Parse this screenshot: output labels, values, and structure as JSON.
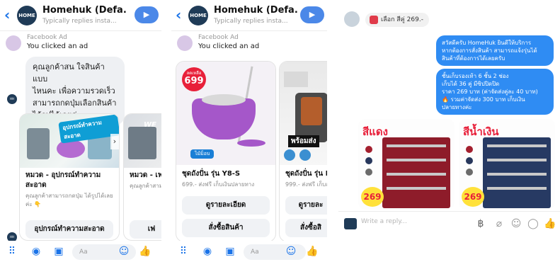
{
  "colors": {
    "accent": "#1a73e8",
    "bubble_blue": "#2f8cf3",
    "brand_dark": "#1f3b57",
    "promo_red": "#e8203a"
  },
  "header": {
    "name": "Homehuk (Defa...",
    "subtitle": "Typically replies insta...",
    "logo_text": "HOME"
  },
  "ad": {
    "label": "Facebook Ad",
    "text": "You clicked an ad"
  },
  "panel1": {
    "bot_message": [
      "คุณลูกค้าสน ใจสินค้าแบบ",
      "ไหนคะ เพื่อความรวดเร็ว",
      "สามารถกดปุ่มเลือกสินค้า",
      "ได้รูปได้เลยค่ะ"
    ],
    "card1": {
      "image_badge": "อุปกรณ์ทำความสะอาด",
      "title": "หมวด - อุปกรณ์ทำความสะอาด",
      "subtitle": "คุณลูกค้าสามารถกดปุ่ม ได้รูปได้เลยค่ะ 👇",
      "button": "อุปกรณ์ทำความสะอาด"
    },
    "card2": {
      "title": "หมวด - เฟ",
      "subtitle": "คุณลูกค้าสามารถ",
      "button": "เฟ"
    }
  },
  "panel2": {
    "card1": {
      "price_label": "ลดเหลือ",
      "price": "699",
      "image_badge": "ไม้ม็อบ",
      "title": "ชุดถังปั่น รุ่น Y8-S",
      "subtitle": "699.- ส่งฟรี เก็บเงินปลายทาง",
      "button1": "ดูรายละเอียด",
      "button2": "สั่งซื้อสินค้า"
    },
    "card2": {
      "image_badge": "พร้อมส่ง",
      "title": "ชุดถังปั่น รุ่น Pr",
      "subtitle": "999.- ส่งฟรี เก็บเ",
      "button1": "ดูรายละ",
      "button2": "สั่งซื้อสิ"
    }
  },
  "panel3": {
    "chip_text": "เลือก สีคู่ 269.-",
    "msg1": [
      "สวัสดีครับ HomeHuk ยินดีให้บริการ",
      "หากต้องการสั่งสินค้า สามารถแจ้งรุ่นได้",
      "สินค้าที่ต้องการได้เลยครับ"
    ],
    "msg2": [
      "ชั้นเก็บรองเท้า 6 ชั้น 2 ช่อง",
      "เก็บได้ 36 คู่ มีซิปปิดปิด",
      "ราคา 269 บาท (ค่าจัดส่งคู่ละ 40 บาท)",
      "🔥 รวมค่าจัดส่ง 300 บาท เก็บเงิน",
      "ปลายทางค่ะ"
    ],
    "color_red": "สีแดง",
    "color_blue": "สีน้ำเงิน",
    "price_red": "269",
    "price_blue": "269",
    "composer_placeholder": "Write a reply..."
  },
  "composer": {
    "placeholder": "Aa"
  }
}
